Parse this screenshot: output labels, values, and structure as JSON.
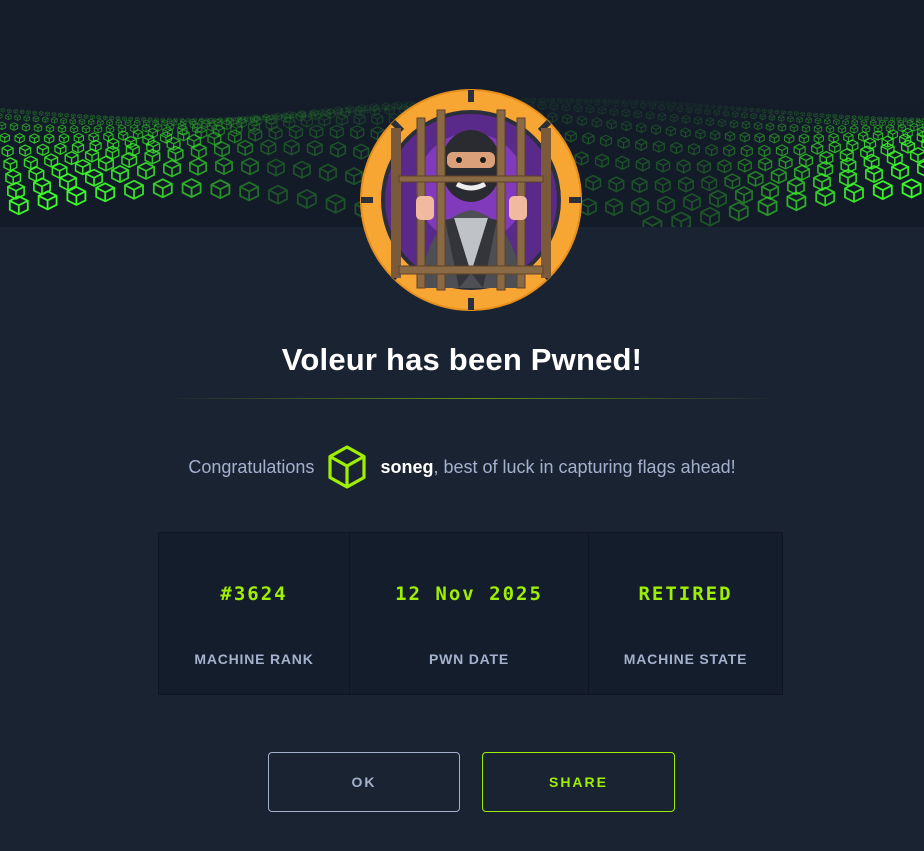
{
  "banner": {
    "image": "green-cube-grid-banner",
    "accent_color": "#9fef00"
  },
  "avatar": {
    "image": "masked-burglar-behind-bars-avatar",
    "ring_color": "#f7a634"
  },
  "title": "Voleur has been Pwned!",
  "congrats": {
    "prefix": "Congratulations",
    "user_icon": "green-cube-icon",
    "username": "soneg",
    "suffix": ", best of luck in capturing flags ahead!"
  },
  "stats": [
    {
      "value": "#3624",
      "label": "MACHINE RANK"
    },
    {
      "value": "12 Nov 2025",
      "label": "PWN DATE"
    },
    {
      "value": "RETIRED",
      "label": "MACHINE STATE"
    }
  ],
  "buttons": {
    "ok": "OK",
    "share": "SHARE"
  },
  "colors": {
    "background": "#1a2332",
    "accent": "#9fef00",
    "muted_text": "#a4b1cd"
  }
}
